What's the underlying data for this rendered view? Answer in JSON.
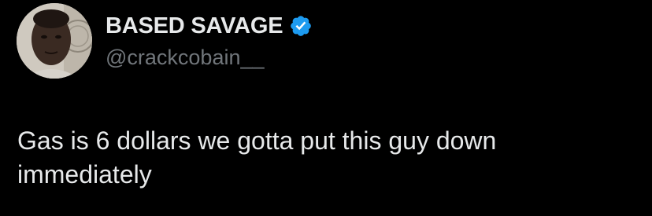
{
  "tweet": {
    "author": {
      "display_name": "BASED SAVAGE",
      "handle": "@crackcobain__",
      "verified": true,
      "verified_icon": "verified-badge-icon",
      "avatar_icon": "profile-photo"
    },
    "text": "Gas is 6 dollars we gotta put this guy down immediately"
  },
  "colors": {
    "background": "#000000",
    "primary_text": "#e7e9ea",
    "secondary_text": "#71767b",
    "verified_blue": "#1d9bf0"
  }
}
